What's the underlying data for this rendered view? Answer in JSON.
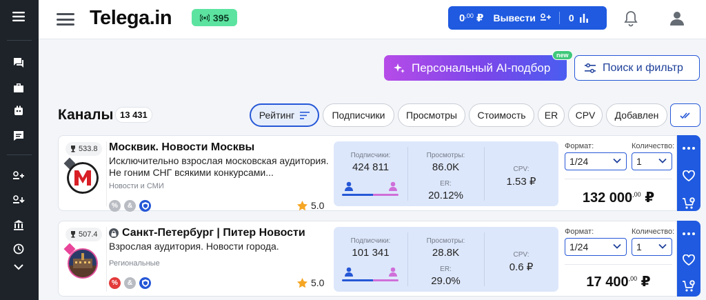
{
  "header": {
    "logo": "Telega.in",
    "live_count": "395",
    "balance_main": "0",
    "balance_frac": ",00",
    "balance_currency": "₽",
    "withdraw_label": "Вывести",
    "stats_count": "0"
  },
  "actions": {
    "ai_label": "Персональный AI-подбор",
    "new_badge": "new",
    "search_label": "Поиск и фильтр"
  },
  "channels": {
    "title": "Каналы",
    "count": "13 431",
    "sort": [
      "Рейтинг",
      "Подписчики",
      "Просмотры",
      "Стоимость",
      "ER",
      "CPV",
      "Добавлен"
    ]
  },
  "labels": {
    "subscribers": "Подписчики:",
    "views": "Просмотры:",
    "er": "ER:",
    "cpv": "CPV:",
    "format": "Формат:",
    "quantity": "Количество:"
  },
  "cards": [
    {
      "rating": "533.8",
      "name": "Москвик. Новости Москвы",
      "desc": "Исключительно взрослая московская аудитория. Не гоним СНГ всякими конкурсами...",
      "category": "Новости и СМИ",
      "score": "5.0",
      "subscribers": "424 811",
      "views": "86.0K",
      "er": "20.12%",
      "cpv": "1.53 ₽",
      "male_share": 0.55,
      "format": "1/24",
      "quantity": "1",
      "price": "132 000",
      "price_frac": ",00",
      "currency": "₽"
    },
    {
      "rating": "507.4",
      "name": "Санкт-Петербург | Питер Новости",
      "desc": "Взрослая аудитория. Новости города.",
      "category": "Региональные",
      "score": "5.0",
      "subscribers": "101 341",
      "views": "28.8K",
      "er": "29.0%",
      "cpv": "0.6 ₽",
      "male_share": 0.55,
      "format": "1/24",
      "quantity": "1",
      "price": "17 400",
      "price_frac": ",00",
      "currency": "₽"
    }
  ],
  "colors": {
    "accent": "#1f5ae0",
    "rail": "#1d2329",
    "live": "#5ce3a0",
    "stats_bg": "#dde7fb"
  }
}
